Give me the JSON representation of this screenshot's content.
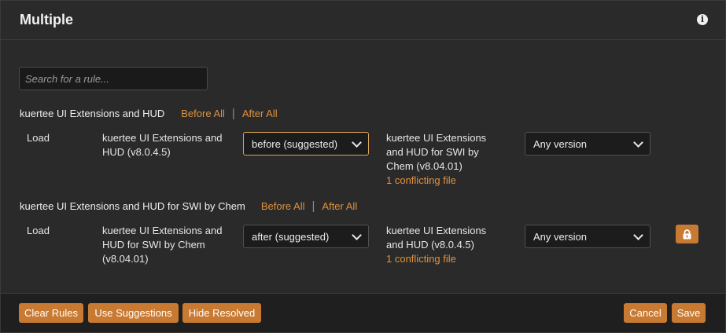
{
  "dialog": {
    "title": "Multiple"
  },
  "search": {
    "placeholder": "Search for a rule..."
  },
  "groups": [
    {
      "name": "kuertee UI Extensions and HUD",
      "before_all": "Before All",
      "after_all": "After All",
      "rule": {
        "type": "Load",
        "source_line1": "kuertee UI Extensions and",
        "source_line2": "HUD (v8.0.4.5)",
        "relation": "before (suggested)",
        "target_line1": "kuertee UI Extensions",
        "target_line2": "and HUD for SWI by",
        "target_line3": "Chem (v8.04.01)",
        "conflict": "1 conflicting file",
        "version": "Any version"
      }
    },
    {
      "name": "kuertee UI Extensions and HUD for SWI by Chem",
      "before_all": "Before All",
      "after_all": "After All",
      "rule": {
        "type": "Load",
        "source_line1": "kuertee UI Extensions and",
        "source_line2": "HUD for SWI by Chem",
        "source_line3": "(v8.04.01)",
        "relation": "after (suggested)",
        "target_line1": "kuertee UI Extensions",
        "target_line2": "and HUD (v8.0.4.5)",
        "conflict": "1 conflicting file",
        "version": "Any version",
        "locked": true
      }
    }
  ],
  "footer": {
    "clear_rules": "Clear Rules",
    "use_suggestions": "Use Suggestions",
    "hide_resolved": "Hide Resolved",
    "cancel": "Cancel",
    "save": "Save"
  },
  "colors": {
    "accent": "#c97a32",
    "link": "#e0913c",
    "background": "#2a2a2b"
  },
  "icons": {
    "info": "info-icon",
    "lock": "lock-icon"
  }
}
